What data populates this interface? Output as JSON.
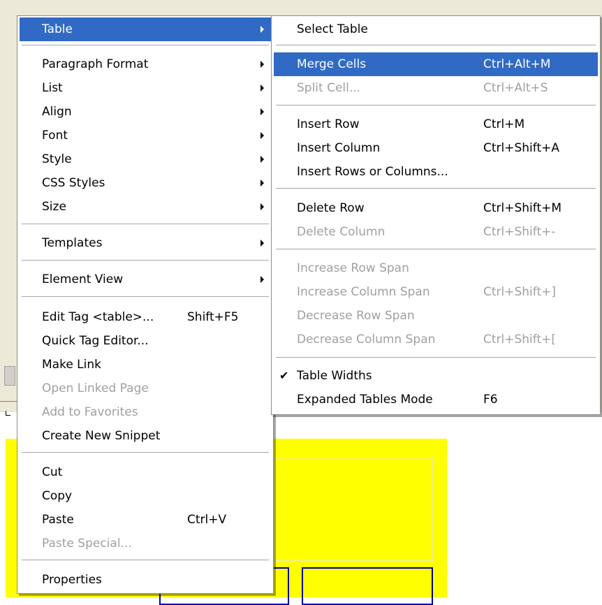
{
  "context_menu": {
    "items": [
      {
        "label": "Table",
        "has_submenu": true,
        "highlighted": true
      },
      {
        "label": "Paragraph Format",
        "has_submenu": true
      },
      {
        "label": "List",
        "has_submenu": true
      },
      {
        "label": "Align",
        "has_submenu": true
      },
      {
        "label": "Font",
        "has_submenu": true
      },
      {
        "label": "Style",
        "has_submenu": true
      },
      {
        "label": "CSS Styles",
        "has_submenu": true
      },
      {
        "label": "Size",
        "has_submenu": true
      },
      {
        "label": "Templates",
        "has_submenu": true
      },
      {
        "label": "Element View",
        "has_submenu": true
      },
      {
        "label": "Edit Tag <table>...",
        "shortcut": "Shift+F5"
      },
      {
        "label": "Quick Tag Editor..."
      },
      {
        "label": "Make Link"
      },
      {
        "label": "Open Linked Page",
        "disabled": true
      },
      {
        "label": "Add to Favorites",
        "disabled": true
      },
      {
        "label": "Create New Snippet"
      },
      {
        "label": "Cut"
      },
      {
        "label": "Copy"
      },
      {
        "label": "Paste",
        "shortcut": "Ctrl+V"
      },
      {
        "label": "Paste Special...",
        "disabled": true
      },
      {
        "label": "Properties"
      }
    ]
  },
  "table_submenu": {
    "items": [
      {
        "label": "Select Table"
      },
      {
        "label": "Merge Cells",
        "shortcut": "Ctrl+Alt+M",
        "highlighted": true
      },
      {
        "label": "Split Cell...",
        "shortcut": "Ctrl+Alt+S",
        "disabled": true
      },
      {
        "label": "Insert Row",
        "shortcut": "Ctrl+M"
      },
      {
        "label": "Insert Column",
        "shortcut": "Ctrl+Shift+A"
      },
      {
        "label": "Insert Rows or Columns..."
      },
      {
        "label": "Delete Row",
        "shortcut": "Ctrl+Shift+M"
      },
      {
        "label": "Delete Column",
        "shortcut": "Ctrl+Shift+-",
        "disabled": true
      },
      {
        "label": "Increase Row Span",
        "disabled": true
      },
      {
        "label": "Increase Column Span",
        "shortcut": "Ctrl+Shift+]",
        "disabled": true
      },
      {
        "label": "Decrease Row Span",
        "disabled": true
      },
      {
        "label": "Decrease Column Span",
        "shortcut": "Ctrl+Shift+[",
        "disabled": true
      },
      {
        "label": "Table Widths",
        "checked": true
      },
      {
        "label": "Expanded Tables Mode",
        "shortcut": "F6"
      }
    ]
  },
  "colors": {
    "menu_highlight": "#316ac5",
    "disabled_text": "#a0a0a0",
    "document_fill": "#ffff00",
    "window_face": "#ece9d8"
  }
}
